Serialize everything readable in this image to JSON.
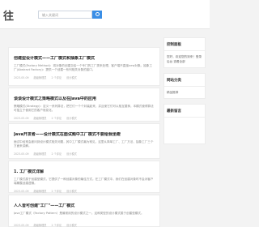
{
  "header": {
    "logo_text": "往",
    "search_placeholder": "输入关键词",
    "search_button_icon": "search-icon"
  },
  "posts": [
    {
      "title": "创建型设计模式——工厂模式和抽象工厂模式",
      "excerpt": "工厂模式(Factory Method)：将对象的创建交给一个专门的工厂类来处理，客户端不直接new对象。抽象工厂(Abstract Factory)：提供一个创建一系列相关对象的接口。",
      "date": "2023-05-09",
      "author": "超级管理员",
      "views": "2 个评论",
      "tag": "设计模式"
    },
    {
      "title": "谈谈设计模式之策略模式以及在Java中的应用",
      "excerpt": "策略模式(Strategy)：定义一系列算法，把它们一个个封装起来，并且使它们可以相互替换，本模式使得算法可独立于使用它的客户而变化。",
      "date": "2023-05-09",
      "author": "超级管理员",
      "views": "2 个评论",
      "tag": "设计模式"
    },
    {
      "title": "Java开发者——设计模式在面试题中工厂模式不要给我坐蹬",
      "excerpt": "面试中经常会被问到设计模式相关问题，其中工厂模式最为常见，这里从简单工厂、工厂方法、抽象工厂三个方面来讲解。",
      "date": "2023-05-09",
      "author": "超级管理员",
      "views": "2 个评论",
      "tag": "设计模式"
    },
    {
      "title": "1. 工厂模式详解",
      "excerpt": "工厂模式属于创建型模式，它提供了一种创建对象的最佳方式。在工厂模式中，我们在创建对象时不会对客户端暴露创建逻辑。",
      "date": "2023-05-09",
      "author": "超级管理员",
      "views": "2 个评论",
      "tag": "设计模式"
    },
    {
      "title": "人人皆可创建\"工厂\"——工厂模式",
      "excerpt": "Java工厂模式（Factory Pattern）是最常用的设计模式之一。这种类型的设计模式属于创建型模式。",
      "date": "2023-05-09",
      "author": "超级管理员",
      "views": "2 个评论",
      "tag": "设计模式"
    }
  ],
  "sidebar": {
    "widget1_title": "控制面板",
    "widget1_body": "您好，欢迎您的到来！登录后台 查看全部",
    "widget2_title": "网站分类",
    "widget2_body": "精品推荐",
    "widget3_title": "最新留言",
    "widget3_body": ""
  }
}
